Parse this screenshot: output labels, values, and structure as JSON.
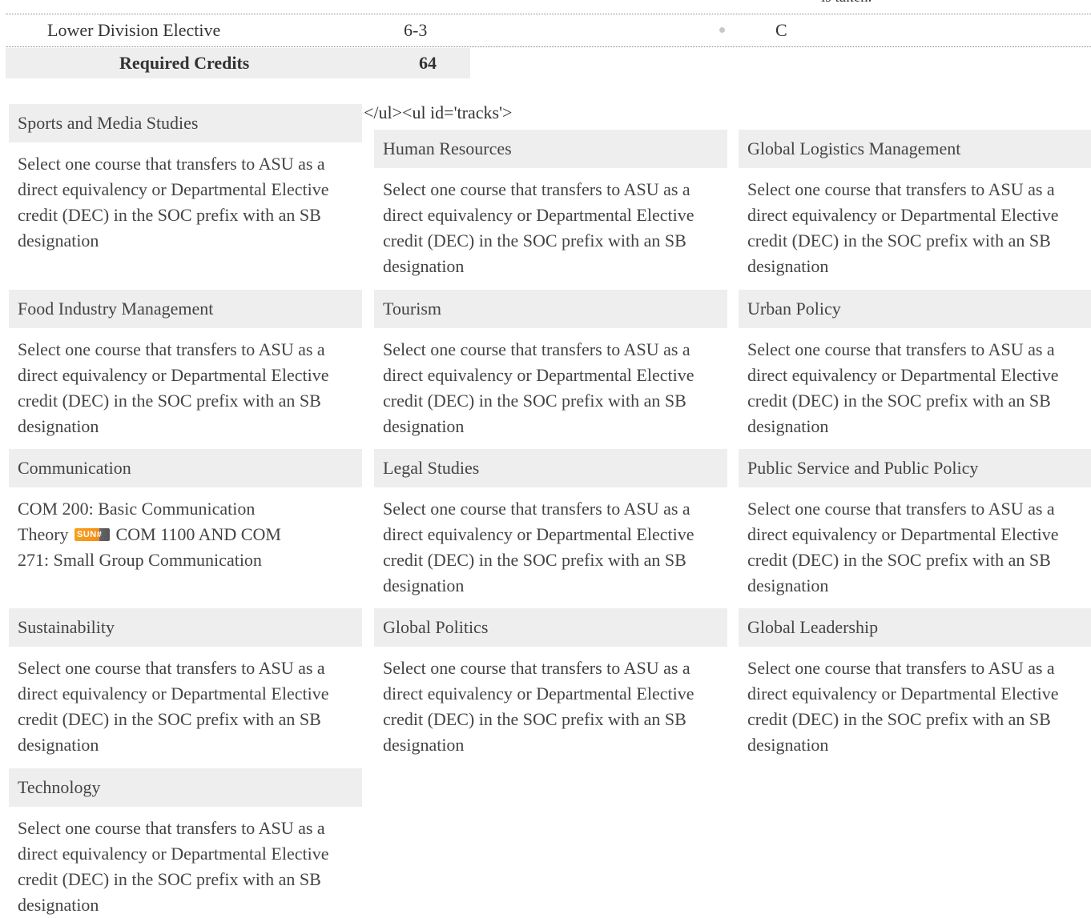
{
  "table": {
    "cut_note": "is taken.",
    "row": {
      "name": "Lower Division Elective",
      "hours": "6-3",
      "grade": "C"
    },
    "credits": {
      "label": "Required Credits",
      "value": "64"
    }
  },
  "stray_markup": "</ul><ul id='tracks'>",
  "tracks": [
    {
      "title": "Sports and Media Studies",
      "text": "Select one course that transfers to ASU as a direct equivalency or Departmental Elective credit (DEC) in the SOC prefix with an SB designation"
    },
    {
      "title": "Human Resources",
      "text": "Select one course that transfers to ASU as a direct equivalency or Departmental Elective credit (DEC) in the SOC prefix with an SB designation"
    },
    {
      "title": "Global Logistics Management",
      "text": "Select one course that transfers to ASU as a direct equivalency or Departmental Elective credit (DEC) in the SOC prefix with an SB designation"
    },
    {
      "title": "Food Industry Management",
      "text": "Select one course that transfers to ASU as a direct equivalency or Departmental Elective credit (DEC) in the SOC prefix with an SB designation"
    },
    {
      "title": "Tourism",
      "text": "Select one course that transfers to ASU as a direct equivalency or Departmental Elective credit (DEC) in the SOC prefix with an SB designation"
    },
    {
      "title": "Urban Policy",
      "text": "Select one course that transfers to ASU as a direct equivalency or Departmental Elective credit (DEC) in the SOC prefix with an SB designation"
    },
    {
      "title": "Communication",
      "text_a": "COM 200: Basic Communication Theory",
      "icon_label": "SUN#",
      "icon": "sun-icon",
      "text_b": "COM 1100 AND COM 271: Small Group Communication"
    },
    {
      "title": "Legal Studies",
      "text": "Select one course that transfers to ASU as a direct equivalency or Departmental Elective credit (DEC) in the SOC prefix with an SB designation"
    },
    {
      "title": "Public Service and Public Policy",
      "text": "Select one course that transfers to ASU as a direct equivalency or Departmental Elective credit (DEC) in the SOC prefix with an SB designation"
    },
    {
      "title": "Sustainability",
      "text": "Select one course that transfers to ASU as a direct equivalency or Departmental Elective credit (DEC) in the SOC prefix with an SB designation"
    },
    {
      "title": "Global Politics",
      "text": "Select one course that transfers to ASU as a direct equivalency or Departmental Elective credit (DEC) in the SOC prefix with an SB designation"
    },
    {
      "title": "Global Leadership",
      "text": "Select one course that transfers to ASU as a direct equivalency or Departmental Elective credit (DEC) in the SOC prefix with an SB designation"
    },
    {
      "title": "Technology",
      "text": "Select one course that transfers to ASU as a direct equivalency or Departmental Elective credit (DEC) in the SOC prefix with an SB designation"
    }
  ],
  "colors": {
    "header_bg": "#eeeeee",
    "text": "#444444",
    "sun_icon": "#f28c18"
  }
}
